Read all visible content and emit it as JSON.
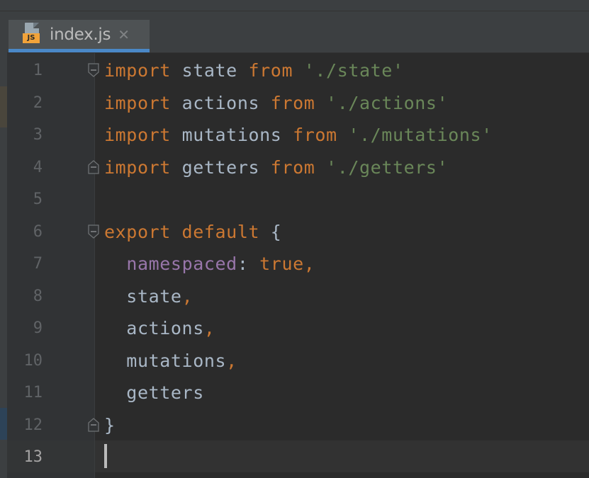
{
  "tab": {
    "title": "index.js",
    "close": "✕",
    "icon_label": "JS",
    "icon": "javascript-file-icon"
  },
  "editor": {
    "lines": [
      {
        "number": "1",
        "tokens": [
          {
            "t": "import",
            "k": "kw"
          },
          {
            "t": " state ",
            "k": "id"
          },
          {
            "t": "from",
            "k": "kw"
          },
          {
            "t": " './state'",
            "k": "str"
          }
        ]
      },
      {
        "number": "2",
        "tokens": [
          {
            "t": "import",
            "k": "kw"
          },
          {
            "t": " actions ",
            "k": "id"
          },
          {
            "t": "from",
            "k": "kw"
          },
          {
            "t": " './actions'",
            "k": "str"
          }
        ]
      },
      {
        "number": "3",
        "tokens": [
          {
            "t": "import",
            "k": "kw"
          },
          {
            "t": " mutations ",
            "k": "id"
          },
          {
            "t": "from",
            "k": "kw"
          },
          {
            "t": " './mutations'",
            "k": "str"
          }
        ]
      },
      {
        "number": "4",
        "tokens": [
          {
            "t": "import",
            "k": "kw"
          },
          {
            "t": " getters ",
            "k": "id"
          },
          {
            "t": "from",
            "k": "kw"
          },
          {
            "t": " './getters'",
            "k": "str"
          }
        ]
      },
      {
        "number": "5",
        "tokens": []
      },
      {
        "number": "6",
        "tokens": [
          {
            "t": "export default",
            "k": "kw"
          },
          {
            "t": " {",
            "k": "id"
          }
        ]
      },
      {
        "number": "7",
        "tokens": [
          {
            "t": "  ",
            "k": "id"
          },
          {
            "t": "namespaced",
            "k": "prop"
          },
          {
            "t": ": ",
            "k": "id"
          },
          {
            "t": "true",
            "k": "kw"
          },
          {
            "t": ",",
            "k": "kw"
          }
        ]
      },
      {
        "number": "8",
        "tokens": [
          {
            "t": "  state",
            "k": "id"
          },
          {
            "t": ",",
            "k": "kw"
          }
        ]
      },
      {
        "number": "9",
        "tokens": [
          {
            "t": "  actions",
            "k": "id"
          },
          {
            "t": ",",
            "k": "kw"
          }
        ]
      },
      {
        "number": "10",
        "tokens": [
          {
            "t": "  mutations",
            "k": "id"
          },
          {
            "t": ",",
            "k": "kw"
          }
        ]
      },
      {
        "number": "11",
        "tokens": [
          {
            "t": "  getters",
            "k": "id"
          }
        ]
      },
      {
        "number": "12",
        "tokens": [
          {
            "t": "}",
            "k": "id"
          }
        ]
      },
      {
        "number": "13",
        "tokens": []
      }
    ],
    "active_line": "13",
    "fold_lines": [
      "1",
      "4",
      "6",
      "12"
    ]
  },
  "colors": {
    "keyword": "#cc7832",
    "string": "#6a8759",
    "property": "#9876aa",
    "identifier": "#a9b7c6",
    "tab_accent": "#4a88c7"
  }
}
